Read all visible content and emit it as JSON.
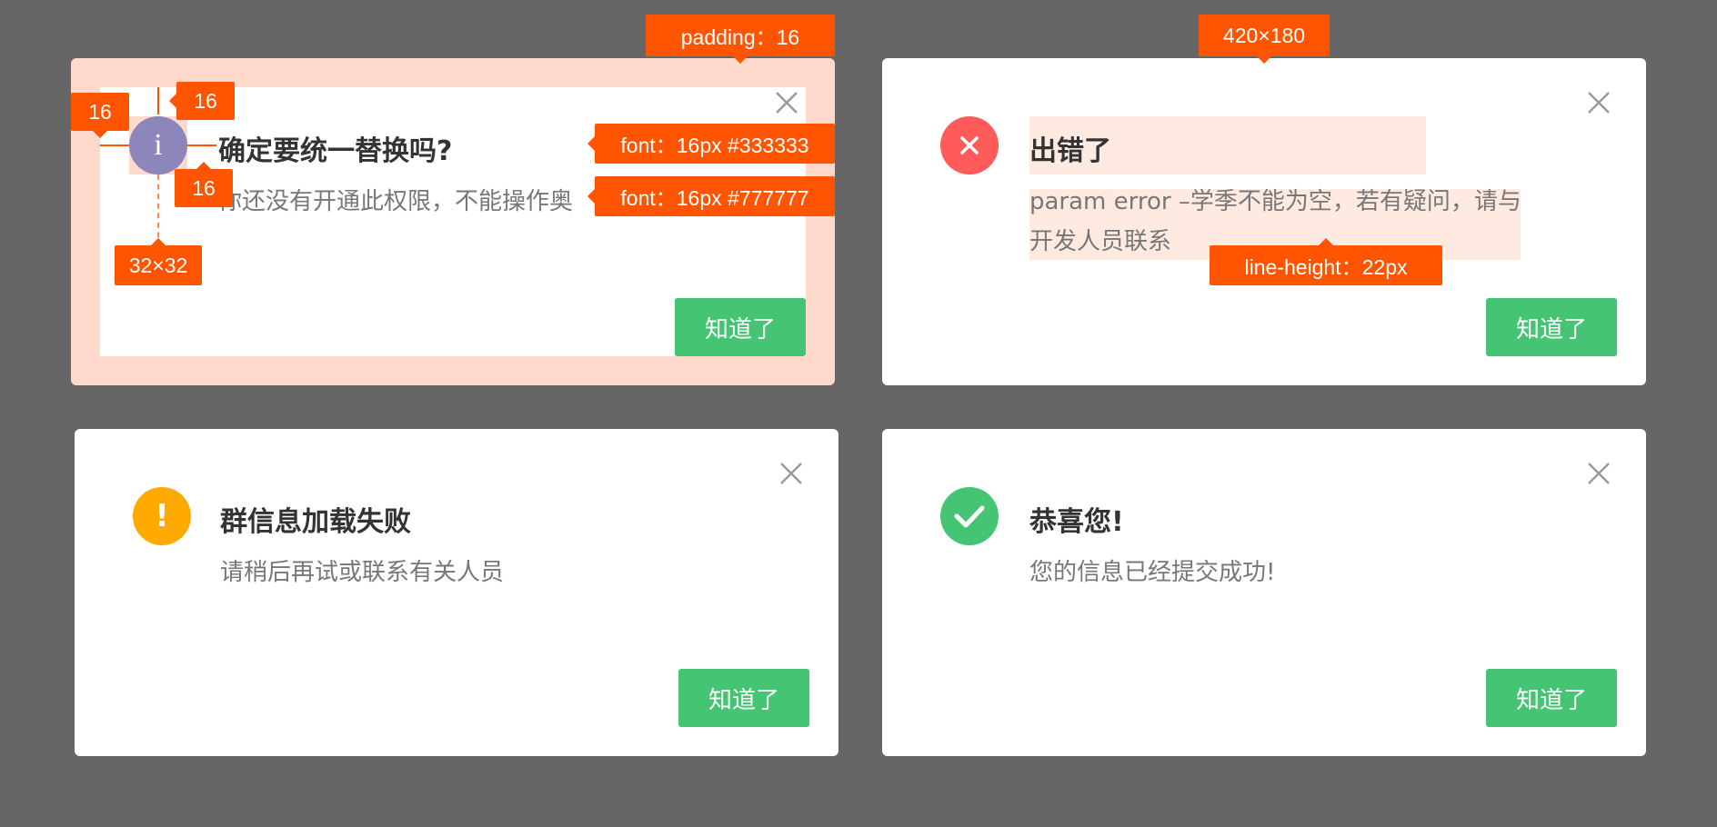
{
  "dialogs": [
    {
      "type": "info",
      "icon": "info-icon",
      "icon_glyph": "i",
      "icon_color": "#8c86bb",
      "title": "确定要统一替换吗?",
      "message": "你还没有开通此权限，不能操作奥",
      "button": "知道了"
    },
    {
      "type": "error",
      "icon": "error-x-icon",
      "icon_color": "#ff5b5b",
      "title": "出错了",
      "message_line1": "param error –学季不能为空，若有疑问，请与",
      "message_line2": "开发人员联系",
      "button": "知道了"
    },
    {
      "type": "warning",
      "icon": "warning-exclamation-icon",
      "icon_glyph": "!",
      "icon_color": "#ffaa00",
      "title": "群信息加载失败",
      "message": "请稍后再试或联系有关人员",
      "button": "知道了"
    },
    {
      "type": "success",
      "icon": "success-check-icon",
      "icon_color": "#45c574",
      "title": "恭喜您!",
      "message": "您的信息已经提交成功!",
      "button": "知道了"
    }
  ],
  "annotations": {
    "padding": "padding：16",
    "icon_margin_left": "16",
    "icon_margin_top": "16",
    "icon_gap": "16",
    "icon_size": "32×32",
    "title_font": "font：16px  #333333",
    "msg_font": "font：16px  #777777",
    "dialog_size": "420×180",
    "line_height": "line-height：22px"
  },
  "colors": {
    "background": "#666666",
    "button": "#45c574",
    "annotation": "#ff5400",
    "padding_highlight": "#ffd9cc",
    "text_title": "#333333",
    "text_message": "#777777"
  }
}
